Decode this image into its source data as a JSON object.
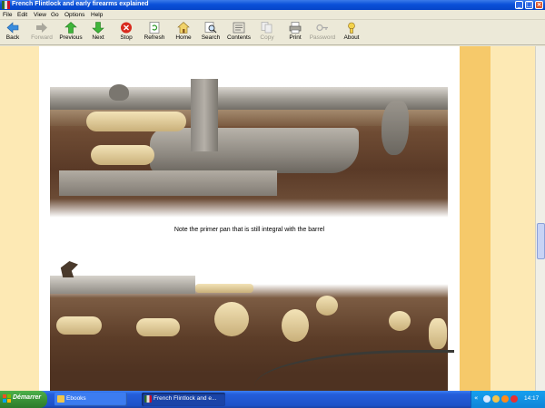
{
  "window": {
    "title": "French Flintlock and early firearms explained",
    "buttons": {
      "minimize": "_",
      "maximize": "□",
      "close": "×"
    }
  },
  "menu": [
    "File",
    "Edit",
    "View",
    "Go",
    "Options",
    "Help"
  ],
  "toolbar": [
    {
      "label": "Back",
      "icon": "arrow-left-icon",
      "enabled": true
    },
    {
      "label": "Forward",
      "icon": "arrow-right-icon",
      "enabled": false
    },
    {
      "label": "Previous",
      "icon": "arrow-up-icon",
      "enabled": true
    },
    {
      "label": "Next",
      "icon": "arrow-down-icon",
      "enabled": true
    },
    {
      "label": "Stop",
      "icon": "stop-icon",
      "enabled": true
    },
    {
      "label": "Refresh",
      "icon": "refresh-icon",
      "enabled": true
    },
    {
      "label": "Home",
      "icon": "home-icon",
      "enabled": true
    },
    {
      "label": "Search",
      "icon": "search-icon",
      "enabled": true
    },
    {
      "label": "Contents",
      "icon": "contents-icon",
      "enabled": true
    },
    {
      "label": "Copy",
      "icon": "copy-icon",
      "enabled": false
    },
    {
      "label": "Print",
      "icon": "print-icon",
      "enabled": true
    },
    {
      "label": "Password",
      "icon": "key-icon",
      "enabled": false
    },
    {
      "label": "About",
      "icon": "about-icon",
      "enabled": true
    }
  ],
  "page": {
    "caption": "Note the primer pan that is still integral with the barrel",
    "colors": {
      "page_bg": "#fde9b4",
      "band": "#f6c96a",
      "content": "#ffffff"
    }
  },
  "taskbar": {
    "start_label": "Démarrer",
    "tasks": [
      {
        "label": "Ebooks",
        "active": false
      },
      {
        "label": "French Flintlock and e...",
        "active": true
      }
    ],
    "tray": {
      "expand": "«",
      "clock": "14:17"
    }
  }
}
